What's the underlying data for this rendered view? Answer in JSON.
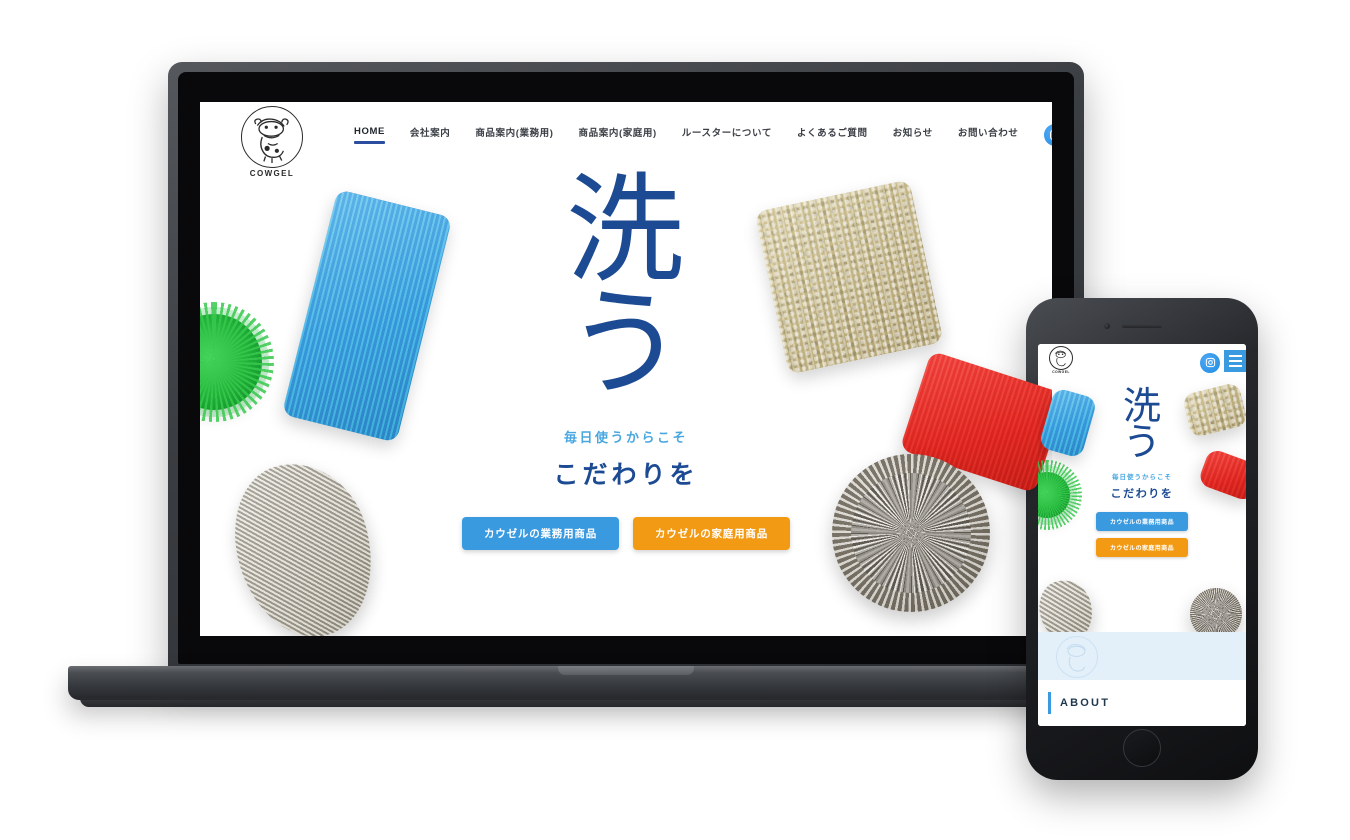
{
  "site": {
    "brand": {
      "name": "COWGEL",
      "logo_icon": "cow-logo-icon"
    },
    "nav": [
      {
        "label": "HOME",
        "active": true
      },
      {
        "label": "会社案内",
        "active": false
      },
      {
        "label": "商品案内(業務用)",
        "active": false
      },
      {
        "label": "商品案内(家庭用)",
        "active": false
      },
      {
        "label": "ルースターについて",
        "active": false
      },
      {
        "label": "よくあるご質問",
        "active": false
      },
      {
        "label": "お知らせ",
        "active": false
      },
      {
        "label": "お問い合わせ",
        "active": false
      }
    ],
    "instagram_icon": "instagram-icon",
    "hero": {
      "kanji_line1": "洗",
      "kanji_line2": "う",
      "tagline_small": "毎日使うからこそ",
      "tagline_large": "こだわりを",
      "cta_primary": "カウゼルの業務用商品",
      "cta_secondary": "カウゼルの家庭用商品"
    }
  },
  "mobile": {
    "brand": {
      "name": "COWGEL"
    },
    "instagram_icon": "instagram-icon",
    "menu_icon": "hamburger-menu-icon",
    "hero": {
      "kanji_line1": "洗",
      "kanji_line2": "う",
      "tagline_small": "毎日使うからこそ",
      "tagline_large": "こだわりを",
      "cta_primary": "カウゼルの業務用商品",
      "cta_secondary": "カウゼルの家庭用商品"
    },
    "about_section_label": "ABOUT"
  },
  "colors": {
    "brand_blue": "#1d4b93",
    "accent_light_blue": "#49a7e0",
    "cta_blue": "#3a9ae0",
    "cta_orange": "#f39a14",
    "nav_underline": "#2b4f9e",
    "mobile_panel_bg": "#e3f0fa"
  }
}
